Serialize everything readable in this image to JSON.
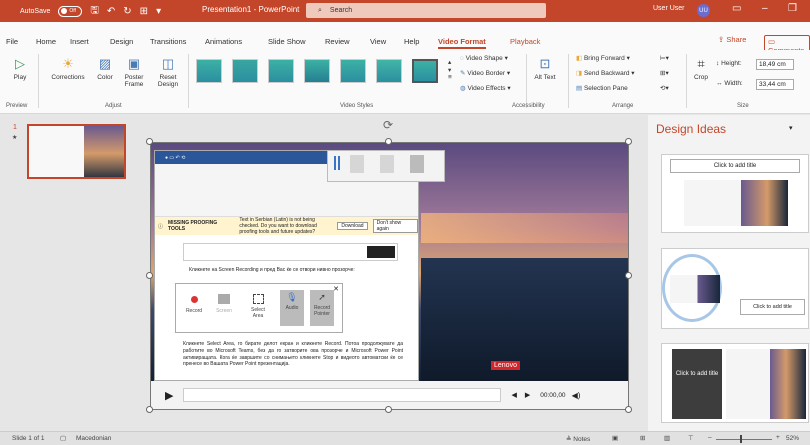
{
  "titlebar": {
    "autosave": "AutoSave",
    "autosave_state": "Off",
    "title": "Presentation1 - PowerPoint",
    "search": "Search",
    "user": "User User",
    "user_initials": "UU"
  },
  "menu": {
    "tabs": [
      "File",
      "Home",
      "Insert",
      "Design",
      "Transitions",
      "Animations",
      "Slide Show",
      "Review",
      "View",
      "Help",
      "Video Format",
      "Playback"
    ],
    "active": "Video Format",
    "share": "Share",
    "comments": "Comments"
  },
  "ribbon": {
    "play": "Play",
    "corrections": "Corrections",
    "color": "Color",
    "poster_frame": "Poster Frame",
    "reset_design": "Reset Design",
    "video_shape": "Video Shape",
    "video_border": "Video Border",
    "video_effects": "Video Effects",
    "alt_text": "Alt Text",
    "bring_forward": "Bring Forward",
    "send_backward": "Send Backward",
    "selection_pane": "Selection Pane",
    "crop": "Crop",
    "height_label": "Height:",
    "height_value": "18,49 cm",
    "width_label": "Width:",
    "width_value": "33,44 cm",
    "groups": {
      "preview": "Preview",
      "adjust": "Adjust",
      "video_styles": "Video Styles",
      "accessibility": "Accessibility",
      "arrange": "Arrange",
      "size": "Size"
    }
  },
  "slides": {
    "number": "1",
    "star": "★"
  },
  "slide": {
    "word_instruction": "Кликнете на Screen Recording и пред Вас ќе се отвори нивно прозорче:",
    "record_buttons": [
      "Record",
      "Screen",
      "Select Area",
      "Audio",
      "Record Pointer"
    ],
    "paragraph": "Кликнете Select Area, го бирате делот екран и кликнете Record. Потоа продолжувате да работите во Microsoft Teams, без да го затворите ова прозорче и Microsoft Power Point активиращата. Кога ќе завршите со снимањето кликнете Stop и видеото автоматски ќе се пренесе во Вашата Power Point презентација.",
    "missing_tools": "MISSING PROOFING TOOLS",
    "missing_text": "Text in Serbian (Latin) is not being checked. Do you want to download proofing tools and future updates?",
    "download": "Download",
    "dont_show": "Don't show again",
    "lenovo": "Lenovo",
    "time": "00:00,00"
  },
  "design_ideas": {
    "title": "Design Ideas",
    "click_add_title": "Click to add title",
    "click_add_title2": "Click to add title",
    "click_add_title3": "Click to add title"
  },
  "status": {
    "slide": "Slide 1 of 1",
    "language": "Macedonian",
    "notes": "Notes",
    "zoom": "52%"
  },
  "colors": {
    "accent": "#c4462a"
  }
}
